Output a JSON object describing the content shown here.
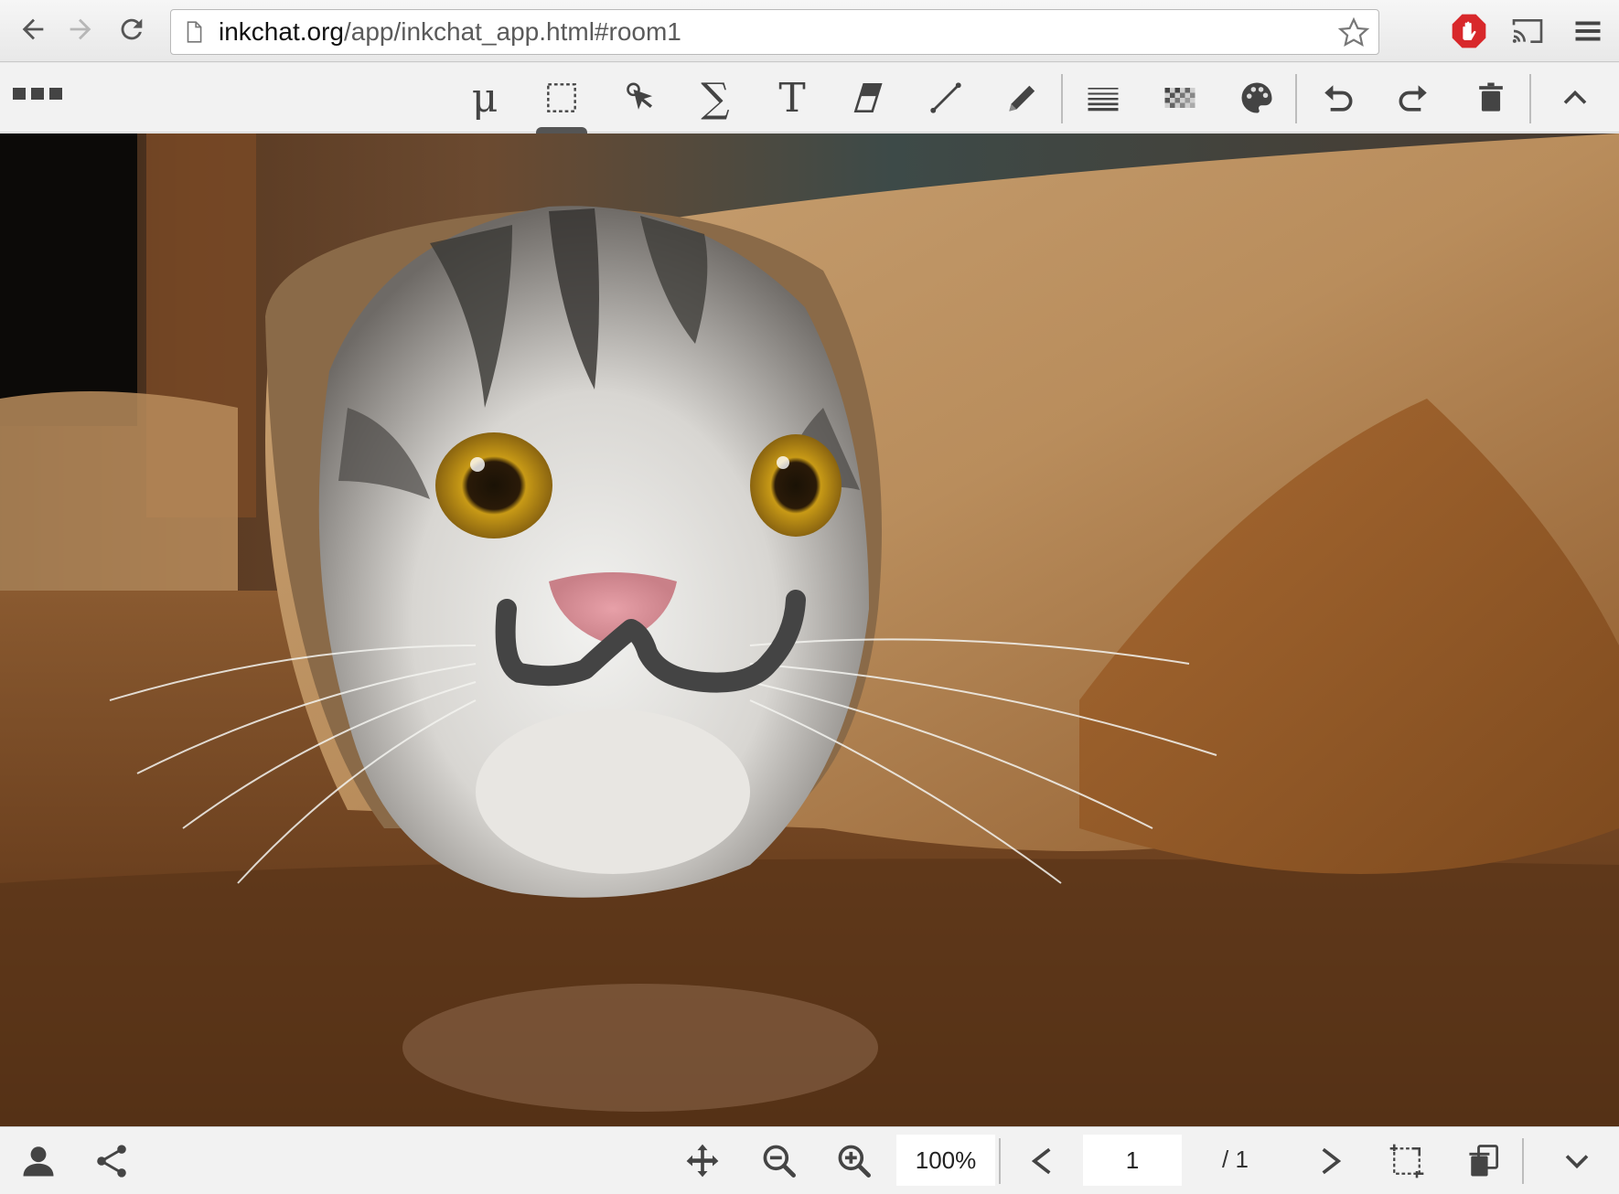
{
  "browser": {
    "url_host": "inkchat.org",
    "url_path": "/app/inkchat_app.html#room1"
  },
  "toolbar": {
    "tools": [
      {
        "name": "mu-tool",
        "icon": "mu-icon",
        "glyph": "μ"
      },
      {
        "name": "select-tool",
        "icon": "dashed-rectangle-icon",
        "active": true
      },
      {
        "name": "pointer-tool",
        "icon": "pointer-icon"
      },
      {
        "name": "math-tool",
        "icon": "sigma-icon",
        "glyph": "∑"
      },
      {
        "name": "text-tool",
        "icon": "text-icon",
        "glyph": "T"
      },
      {
        "name": "eraser-tool",
        "icon": "eraser-icon"
      },
      {
        "name": "line-tool",
        "icon": "line-icon"
      },
      {
        "name": "pencil-tool",
        "icon": "pencil-icon"
      },
      {
        "name": "line-width-tool",
        "icon": "line-width-icon"
      },
      {
        "name": "opacity-tool",
        "icon": "checkerboard-icon"
      },
      {
        "name": "color-tool",
        "icon": "palette-icon"
      },
      {
        "name": "undo-button",
        "icon": "undo-icon"
      },
      {
        "name": "redo-button",
        "icon": "redo-icon"
      },
      {
        "name": "delete-button",
        "icon": "trash-icon"
      },
      {
        "name": "collapse-button",
        "icon": "chevron-up-icon"
      }
    ]
  },
  "bottombar": {
    "zoom_value": "100%",
    "page_value": "1",
    "page_total": "/ 1"
  },
  "colors": {
    "ink": "#444444",
    "toolbar_bg": "#f2f2f2"
  }
}
